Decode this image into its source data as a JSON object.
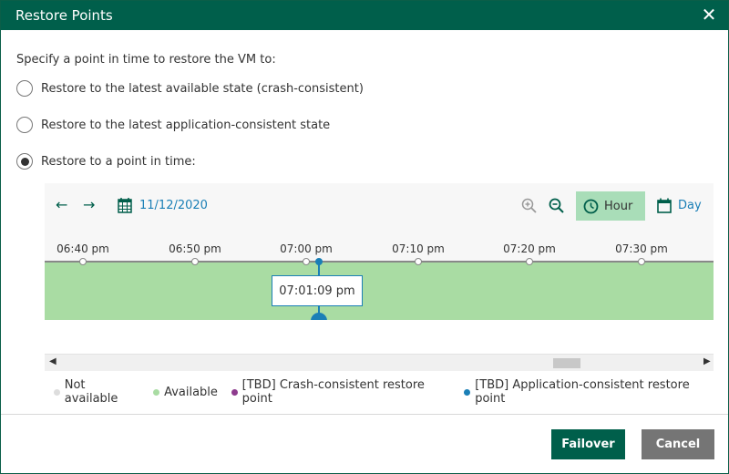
{
  "window": {
    "title": "Restore Points",
    "close_icon": "close-icon"
  },
  "prompt": "Specify a point in time to restore the VM to:",
  "options": [
    {
      "label": "Restore to the latest available state (crash-consistent)",
      "selected": false
    },
    {
      "label": "Restore to the latest application-consistent state",
      "selected": false
    },
    {
      "label": "Restore to a point in time:",
      "selected": true
    }
  ],
  "timeline": {
    "date": "11/12/2020",
    "hour_label": "Hour",
    "day_label": "Day",
    "ticks": [
      "06:40 pm",
      "06:50 pm",
      "07:00 pm",
      "07:10 pm",
      "07:20 pm",
      "07:30 pm"
    ],
    "selected_time": "07:01:09 pm"
  },
  "legend": [
    {
      "label": "Not available",
      "color": "#dddddd"
    },
    {
      "label": "Available",
      "color": "#a9dca3"
    },
    {
      "label": "[TBD] Crash-consistent restore point",
      "color": "#8e3b8e"
    },
    {
      "label": "[TBD] Application-consistent restore point",
      "color": "#1a7fb6"
    }
  ],
  "buttons": {
    "failover": "Failover",
    "cancel": "Cancel"
  },
  "colors": {
    "titlebar": "#005f4b",
    "available": "#a9dca3",
    "accent": "#1a7fb6",
    "cancel": "#757575"
  }
}
